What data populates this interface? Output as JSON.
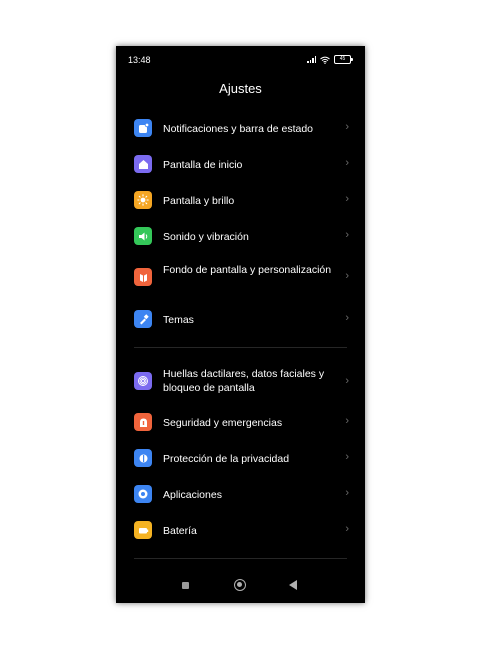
{
  "status_bar": {
    "time": "13:48",
    "battery": "45"
  },
  "header": {
    "title": "Ajustes"
  },
  "settings": {
    "items": [
      {
        "label": "Notificaciones y barra de estado",
        "icon": "notification-icon",
        "color": "#3d85f2"
      },
      {
        "label": "Pantalla de inicio",
        "icon": "home-icon",
        "color": "#7b6bf0"
      },
      {
        "label": "Pantalla y brillo",
        "icon": "sun-icon",
        "color": "#f5a623"
      },
      {
        "label": "Sonido y vibración",
        "icon": "speaker-icon",
        "color": "#34c759"
      },
      {
        "label": "Fondo de pantalla y personalización",
        "icon": "wallpaper-icon",
        "color": "#f0643c"
      },
      {
        "label": "Temas",
        "icon": "brush-icon",
        "color": "#3d85f2"
      },
      {
        "label": "Huellas dactilares, datos faciales y bloqueo de pantalla",
        "icon": "fingerprint-icon",
        "color": "#7b6bf0"
      },
      {
        "label": "Seguridad y emergencias",
        "icon": "emergency-icon",
        "color": "#f0643c"
      },
      {
        "label": "Protección de la privacidad",
        "icon": "privacy-icon",
        "color": "#3d85f2"
      },
      {
        "label": "Aplicaciones",
        "icon": "apps-gear-icon",
        "color": "#3d85f2"
      },
      {
        "label": "Batería",
        "icon": "battery-icon",
        "color": "#f5b323"
      }
    ]
  },
  "chevron": "›"
}
